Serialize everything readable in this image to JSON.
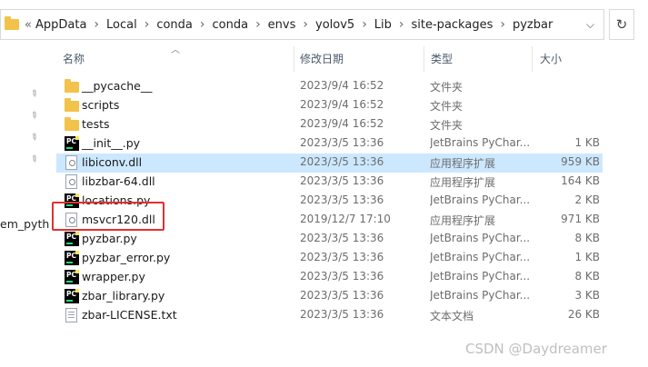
{
  "address_bar": {
    "overflow": "«",
    "crumbs": [
      "AppData",
      "Local",
      "conda",
      "conda",
      "envs",
      "yolov5",
      "Lib",
      "site-packages",
      "pyzbar"
    ],
    "refresh_icon": "refresh-icon"
  },
  "nav": {
    "partial_label": "em_pyth"
  },
  "columns": {
    "name": "名称",
    "date": "修改日期",
    "type": "类型",
    "size": "大小"
  },
  "files": [
    {
      "name": "__pycache__",
      "date": "2023/9/4 16:52",
      "type": "文件夹",
      "size": "",
      "icon": "folder"
    },
    {
      "name": "scripts",
      "date": "2023/9/4 16:52",
      "type": "文件夹",
      "size": "",
      "icon": "folder"
    },
    {
      "name": "tests",
      "date": "2023/9/4 16:52",
      "type": "文件夹",
      "size": "",
      "icon": "folder"
    },
    {
      "name": "__init__.py",
      "date": "2023/3/5 13:36",
      "type": "JetBrains PyChar...",
      "size": "1 KB",
      "icon": "pycharm"
    },
    {
      "name": "libiconv.dll",
      "date": "2023/3/5 13:36",
      "type": "应用程序扩展",
      "size": "959 KB",
      "icon": "dll"
    },
    {
      "name": "libzbar-64.dll",
      "date": "2023/3/5 13:36",
      "type": "应用程序扩展",
      "size": "164 KB",
      "icon": "dll"
    },
    {
      "name": "locations.py",
      "date": "2023/3/5 13:36",
      "type": "JetBrains PyChar...",
      "size": "2 KB",
      "icon": "pycharm"
    },
    {
      "name": "msvcr120.dll",
      "date": "2019/12/7 17:10",
      "type": "应用程序扩展",
      "size": "971 KB",
      "icon": "dll"
    },
    {
      "name": "pyzbar.py",
      "date": "2023/3/5 13:36",
      "type": "JetBrains PyChar...",
      "size": "8 KB",
      "icon": "pycharm"
    },
    {
      "name": "pyzbar_error.py",
      "date": "2023/3/5 13:36",
      "type": "JetBrains PyChar...",
      "size": "1 KB",
      "icon": "pycharm"
    },
    {
      "name": "wrapper.py",
      "date": "2023/3/5 13:36",
      "type": "JetBrains PyChar...",
      "size": "8 KB",
      "icon": "pycharm"
    },
    {
      "name": "zbar_library.py",
      "date": "2023/3/5 13:36",
      "type": "JetBrains PyChar...",
      "size": "3 KB",
      "icon": "pycharm"
    },
    {
      "name": "zbar-LICENSE.txt",
      "date": "2023/3/5 13:36",
      "type": "文本文档",
      "size": "26 KB",
      "icon": "txt"
    }
  ],
  "selected_index": 4,
  "highlight_color": "#e03030",
  "selection_color": "#cce8ff",
  "watermark": "CSDN @Daydreamer"
}
